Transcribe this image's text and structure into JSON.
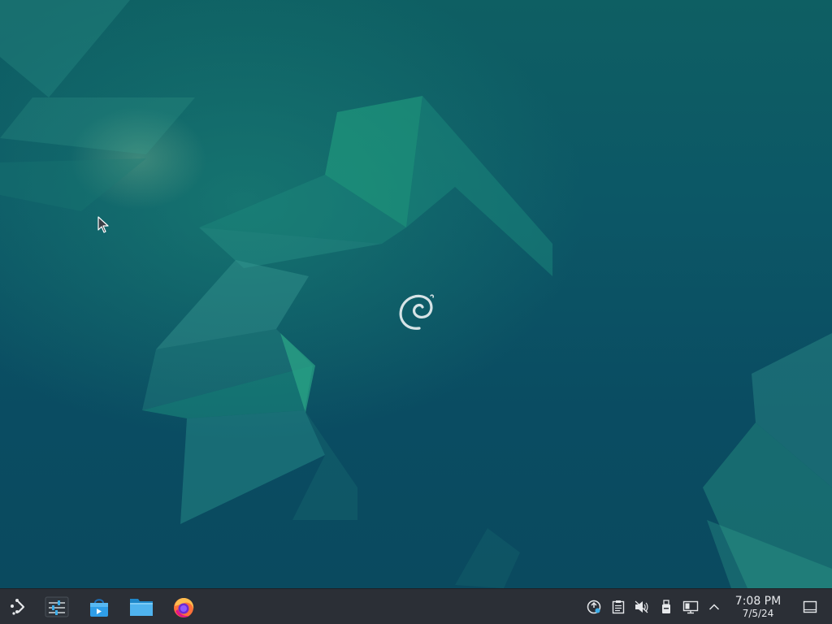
{
  "desktop": {
    "wallpaper": "debian-emerald-geometric",
    "colors": {
      "background": "#0b4a5c",
      "accent": "#1b8c7a",
      "taskbar": "#2b2f36",
      "taskbar_text": "#e8eaed"
    },
    "center_logo": "debian-swirl-logo",
    "cursor": "arrow-cursor"
  },
  "taskbar": {
    "launcher": {
      "icon": "application-launcher-icon"
    },
    "pinned_apps": [
      {
        "name": "system-settings",
        "icon": "sliders-icon"
      },
      {
        "name": "discover",
        "icon": "store-bag-icon"
      },
      {
        "name": "dolphin",
        "icon": "folder-icon"
      },
      {
        "name": "firefox",
        "icon": "firefox-icon"
      }
    ],
    "tray": [
      {
        "name": "network-manager",
        "icon": "network-icon"
      },
      {
        "name": "clipboard",
        "icon": "clipboard-icon"
      },
      {
        "name": "audio-volume",
        "icon": "volume-muted-icon"
      },
      {
        "name": "removable-devices",
        "icon": "usb-drive-icon"
      },
      {
        "name": "display-config",
        "icon": "display-icon"
      },
      {
        "name": "show-hidden-icons",
        "icon": "chevron-up-icon"
      }
    ],
    "clock": {
      "time": "7:08 PM",
      "date": "7/5/24"
    },
    "show_desktop": {
      "icon": "show-desktop-icon"
    }
  }
}
